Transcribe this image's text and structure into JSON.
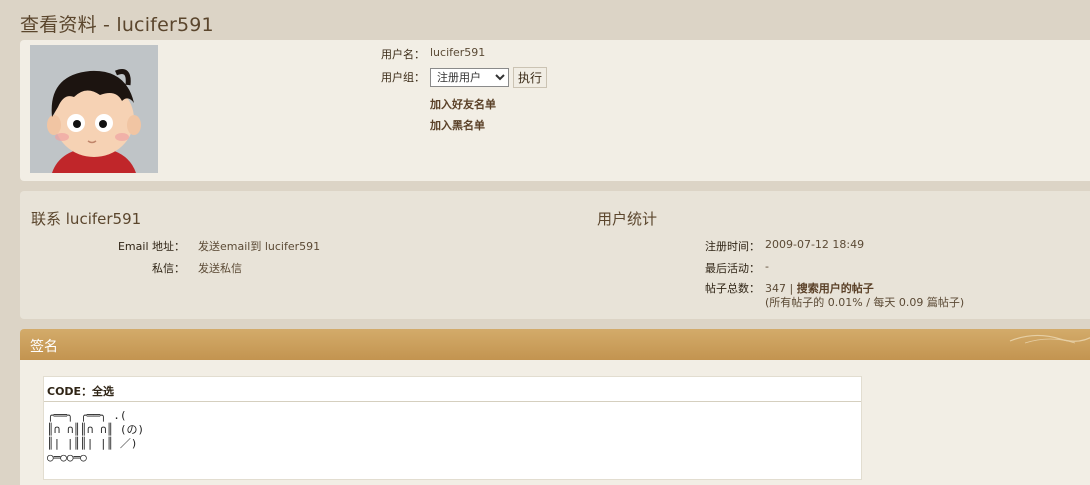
{
  "page": {
    "title": "查看资料 - lucifer591"
  },
  "profile": {
    "avatar_alt": "avatar",
    "username_label": "用户名：",
    "username": "lucifer591",
    "group_label": "用户组：",
    "group_selected": "注册用户",
    "exec_button": "执行",
    "add_friend": "加入好友名单",
    "add_blacklist": "加入黑名单"
  },
  "contact": {
    "title": "联系 lucifer591",
    "email_label": "Email 地址：",
    "email_value": "发送email到 lucifer591",
    "pm_label": "私信：",
    "pm_value": "发送私信"
  },
  "stats": {
    "title": "用户统计",
    "reg_label": "注册时间：",
    "reg_value": "2009-07-12 18:49",
    "last_label": "最后活动：",
    "last_value": "-",
    "posts_label": "帖子总数：",
    "posts_count": "347",
    "posts_sep": "|",
    "posts_search": "搜索用户的帖子",
    "posts_detail": "(所有帖子的 0.01% / 每天 0.09 篇帖子)"
  },
  "signature": {
    "title": "签名",
    "code_label": "CODE：",
    "select_all": "全选",
    "code_lines": "╭══╮ ╭══╮ .(\n║∩ ∩║║∩ ∩║ (の)\n║| |║║| |║ ／)\n○═○○═○"
  },
  "colors": {
    "background": "#dcd4c6",
    "panel": "#f2eee5",
    "panel_alt": "#e8e3d8",
    "header_gold": "#c9a060",
    "text_brown": "#5b462d"
  }
}
